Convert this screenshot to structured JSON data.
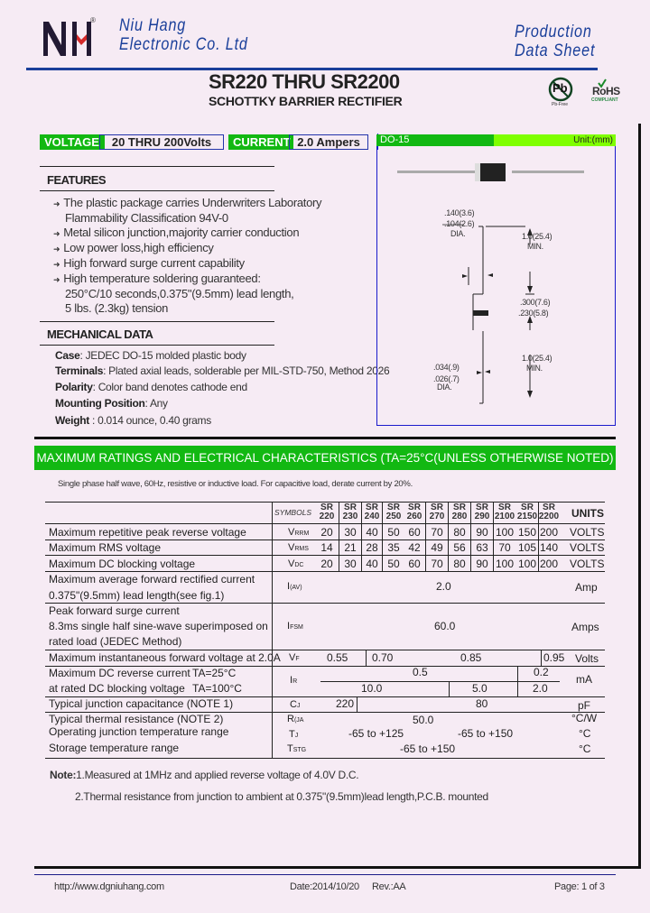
{
  "header": {
    "company_line1": "Niu Hang",
    "company_line2": "Electronic Co. Ltd",
    "registered_mark": "®",
    "doc_type_line1": "Production",
    "doc_type_line2": "Data Sheet",
    "title": "SR220 THRU SR2200",
    "subtitle": "SCHOTTKY BARRIER RECTIFIER",
    "pb_free_label": "Pb",
    "pb_free_caption": "Pb-Free",
    "rohs_label": "RoHS",
    "rohs_caption": "COMPLIANT"
  },
  "colors": {
    "brand_blue": "#1a3f9a",
    "green": "#12b812",
    "light_green": "#7fff00",
    "logo_red": "#d42a2a"
  },
  "ratings_bar": {
    "voltage_label": "VOLTAGE",
    "voltage_value": "20 THRU 200Volts",
    "current_label": "CURRENT",
    "current_value": "2.0 Ampers"
  },
  "features": {
    "heading": "FEATURES",
    "items": [
      {
        "line1": "The plastic package carries Underwriters Laboratory",
        "line2": "Flammability Classification 94V-0"
      },
      {
        "line1": "Metal silicon junction,majority carrier conduction"
      },
      {
        "line1": "Low power loss,high efficiency"
      },
      {
        "line1": "High forward surge current capability"
      },
      {
        "line1": "High temperature soldering guaranteed:",
        "line2": "250°C/10 seconds,0.375\"(9.5mm) lead length,",
        "line3": "5 lbs. (2.3kg) tension"
      }
    ]
  },
  "mechanical": {
    "heading": "MECHANICAL DATA",
    "items": [
      {
        "label": "Case",
        "value": ": JEDEC DO-15 molded plastic body"
      },
      {
        "label": "Terminals",
        "value": ": Plated axial leads, solderable per MIL-STD-750, Method 2026"
      },
      {
        "label": "Polarity",
        "value": ": Color band denotes cathode end"
      },
      {
        "label": "Mounting Position",
        "value": ": Any"
      },
      {
        "label": "Weight",
        "value": " : 0.014 ounce, 0.40 grams"
      }
    ]
  },
  "package": {
    "name": "DO-15",
    "unit": "Unit:(mm)",
    "dims": {
      "body_dia_max": ".140(3.6)",
      "body_dia_min": ".104(2.6)",
      "body_dia_label": "DIA.",
      "lead_len_top": "1.0(25.4)",
      "lead_len_top_label": "MIN.",
      "body_len_max": ".300(7.6)",
      "body_len_min": ".230(5.8)",
      "lead_len_bottom": "1.0(25.4)",
      "lead_len_bottom_label": "MIN.",
      "lead_dia_max": ".034(.9)",
      "lead_dia_min": ".026(.7)",
      "lead_dia_label": "DIA."
    }
  },
  "ratings": {
    "band_title": "MAXIMUM RATINGS AND ELECTRICAL CHARACTERISTICS (TA=25°C(UNLESS OTHERWISE NOTED)",
    "condition_note": "Single phase half wave, 60Hz, resistive or inductive load. For capacitive load, derate current by 20%.",
    "symbols_header": "SYMBOLS",
    "units_header": "UNITS",
    "parts": [
      {
        "top": "SR",
        "bottom": "220"
      },
      {
        "top": "SR",
        "bottom": "230"
      },
      {
        "top": "SR",
        "bottom": "240"
      },
      {
        "top": "SR",
        "bottom": "250"
      },
      {
        "top": "SR",
        "bottom": "260"
      },
      {
        "top": "SR",
        "bottom": "270"
      },
      {
        "top": "SR",
        "bottom": "280"
      },
      {
        "top": "SR",
        "bottom": "290"
      },
      {
        "top": "SR",
        "bottom": "2100"
      },
      {
        "top": "SR",
        "bottom": "2150"
      },
      {
        "top": "SR",
        "bottom": "2200"
      }
    ],
    "rows": {
      "vrrm": {
        "param": "Maximum repetitive peak reverse voltage",
        "sym": "V",
        "sub": "RRM",
        "values": [
          "20",
          "30",
          "40",
          "50",
          "60",
          "70",
          "80",
          "90",
          "100",
          "150",
          "200"
        ],
        "unit": "VOLTS"
      },
      "vrms": {
        "param": "Maximum RMS voltage",
        "sym": "V",
        "sub": "RMS",
        "values": [
          "14",
          "21",
          "28",
          "35",
          "42",
          "49",
          "56",
          "63",
          "70",
          "105",
          "140"
        ],
        "unit": "VOLTS"
      },
      "vdc": {
        "param": "Maximum DC blocking voltage",
        "sym": "V",
        "sub": "DC",
        "values": [
          "20",
          "30",
          "40",
          "50",
          "60",
          "70",
          "80",
          "90",
          "100",
          "100",
          "200"
        ],
        "unit": "VOLTS"
      },
      "iav": {
        "param1": "Maximum average forward rectified current",
        "param2": "0.375\"(9.5mm) lead length(see fig.1)",
        "sym": "I",
        "sub": "(AV)",
        "value": "2.0",
        "unit": "Amp"
      },
      "ifsm": {
        "param1": "Peak forward surge current",
        "param2": "8.3ms single half sine-wave superimposed on",
        "param3": "rated load (JEDEC Method)",
        "sym": "I",
        "sub": "FSM",
        "value": "60.0",
        "unit": "Amps"
      },
      "vf": {
        "param": "Maximum instantaneous forward voltage at 2.0A",
        "sym": "V",
        "sub": "F",
        "v1": "0.55",
        "v2": "0.70",
        "v3": "0.85",
        "v4": "0.95",
        "unit": "Volts"
      },
      "ir": {
        "param1": "Maximum DC reverse current",
        "cond1": "TA=25°C",
        "param2": "at rated DC blocking voltage",
        "cond2": "TA=100°C",
        "sym": "I",
        "sub": "R",
        "r25_a": "0.5",
        "r25_b": "0.2",
        "r100_a": "10.0",
        "r100_b": "5.0",
        "r100_c": "2.0",
        "unit": "mA"
      },
      "cj": {
        "param": "Typical junction capacitance (NOTE 1)",
        "sym": "C",
        "sub": "J",
        "v1": "220",
        "v2": "80",
        "unit": "pF"
      },
      "rthja": {
        "param": "Typical thermal resistance (NOTE 2)",
        "sym": "R",
        "sub": "(JA",
        "value": "50.0",
        "unit": "°C/W"
      },
      "tj": {
        "param": "Operating junction temperature range",
        "sym": "T",
        "sub": "J",
        "v1": "-65 to +125",
        "v2": "-65 to +150",
        "unit": "°C"
      },
      "tstg": {
        "param": "Storage temperature range",
        "sym": "T",
        "sub": "STG",
        "value": "-65 to +150",
        "unit": "°C"
      }
    }
  },
  "notes": {
    "label": "Note:",
    "note1": "1.Measured at 1MHz and applied reverse voltage of 4.0V D.C.",
    "note2": "2.Thermal resistance from junction to ambient  at 0.375\"(9.5mm)lead length,P.C.B. mounted"
  },
  "footer": {
    "url": "http://www.dgniuhang.com",
    "date": "Date:2014/10/20",
    "rev": "Rev.:AA",
    "page": "Page: 1 of 3"
  }
}
